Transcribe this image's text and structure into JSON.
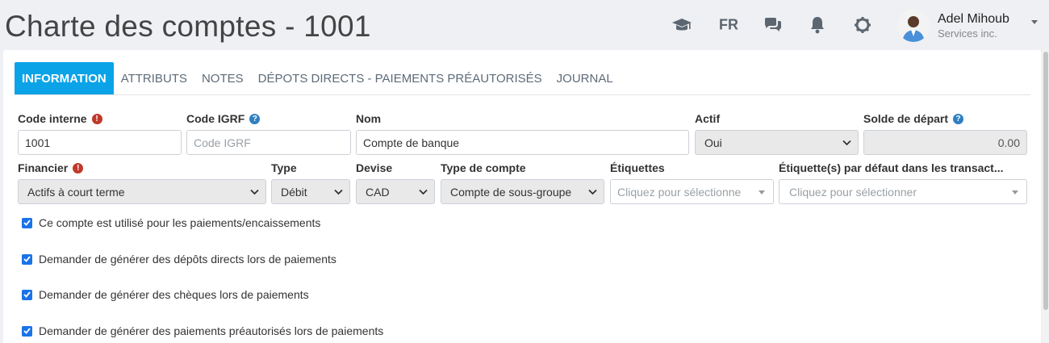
{
  "page": {
    "title": "Charte des comptes - 1001"
  },
  "topbar": {
    "icons": [
      "graduation-cap-icon",
      "chat-icon",
      "bell-icon",
      "gear-icon"
    ],
    "language": "FR",
    "user": {
      "name": "Adel Mihoub",
      "company": "Services inc."
    }
  },
  "tabs": [
    {
      "label": "INFORMATION",
      "active": true
    },
    {
      "label": "ATTRIBUTS",
      "active": false
    },
    {
      "label": "NOTES",
      "active": false
    },
    {
      "label": "DÉPOTS DIRECTS - PAIEMENTS PRÉAUTORISÉS",
      "active": false
    },
    {
      "label": "JOURNAL",
      "active": false
    }
  ],
  "form": {
    "code_interne": {
      "label": "Code interne",
      "value": "1001"
    },
    "code_igrf": {
      "label": "Code IGRF",
      "placeholder": "Code IGRF",
      "value": ""
    },
    "nom": {
      "label": "Nom",
      "value": "Compte de banque"
    },
    "actif": {
      "label": "Actif",
      "value": "Oui"
    },
    "solde_depart": {
      "label": "Solde de départ",
      "value": "0.00"
    },
    "financier": {
      "label": "Financier",
      "value": "Actifs à court terme"
    },
    "type": {
      "label": "Type",
      "value": "Débit"
    },
    "devise": {
      "label": "Devise",
      "value": "CAD"
    },
    "type_compte": {
      "label": "Type de compte",
      "value": "Compte de sous-groupe"
    },
    "etiquettes": {
      "label": "Étiquettes",
      "placeholder": "Cliquez pour sélectionne"
    },
    "etiquettes_defaut": {
      "label": "Étiquette(s) par défaut dans les transact...",
      "placeholder": "Cliquez pour sélectionner"
    }
  },
  "checkboxes": [
    {
      "label": "Ce compte est utilisé pour les paiements/encaissements",
      "checked": true
    },
    {
      "label": "Demander de générer des dépôts directs lors de paiements",
      "checked": true
    },
    {
      "label": "Demander de générer des chèques lors de paiements",
      "checked": true
    },
    {
      "label": "Demander de générer des paiements préautorisés lors de paiements",
      "checked": true
    }
  ],
  "colors": {
    "accent": "#0aa3e8",
    "checkbox": "#1a73e8",
    "warn": "#c0392b",
    "help": "#2f7fc1"
  }
}
